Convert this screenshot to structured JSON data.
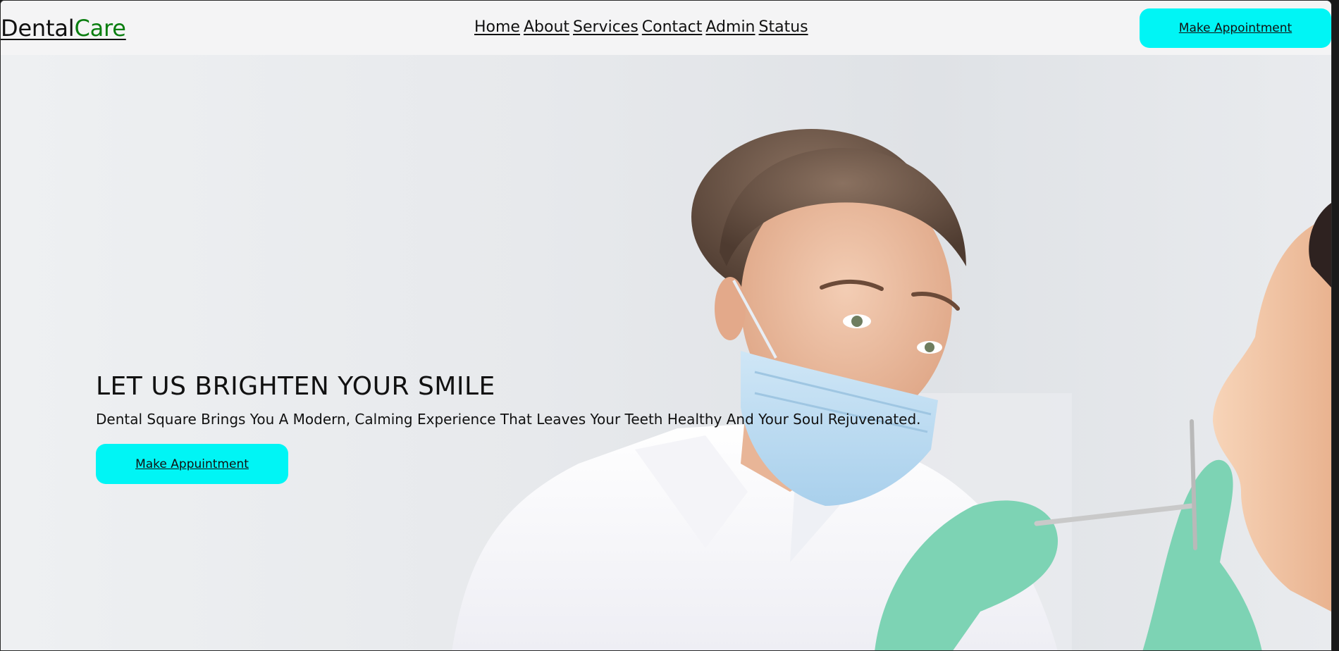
{
  "logo": {
    "part1": "Dental",
    "part2": "Care"
  },
  "nav": {
    "items": [
      "Home",
      "About",
      "Services",
      "Contact",
      "Admin",
      "Status"
    ]
  },
  "header": {
    "cta_label": "Make Appointment"
  },
  "hero": {
    "title": "LET US BRIGHTEN YOUR SMILE",
    "subtitle": "Dental Square Brings You A Modern, Calming Experience That Leaves Your Teeth Healthy And Your Soul Rejuvenated.",
    "cta_label": "Make Appuintment"
  },
  "colors": {
    "accent_cyan": "#00f5f5",
    "brand_green": "#0a7e10",
    "header_bg": "#f4f4f5",
    "text": "#111111"
  }
}
